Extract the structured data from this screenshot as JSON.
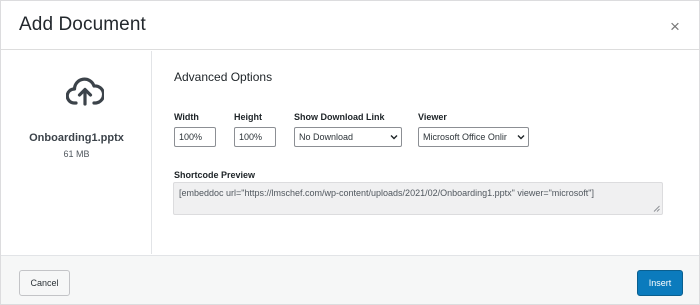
{
  "dialog": {
    "title": "Add Document",
    "close_glyph": "×"
  },
  "file": {
    "icon": "cloud-upload-icon",
    "name": "Onboarding1.pptx",
    "size": "61 MB"
  },
  "options": {
    "section_title": "Advanced Options",
    "width": {
      "label": "Width",
      "value": "100%"
    },
    "height": {
      "label": "Height",
      "value": "100%"
    },
    "download": {
      "label": "Show Download Link",
      "selected": "No Download"
    },
    "viewer": {
      "label": "Viewer",
      "selected": "Microsoft Office Onlir"
    }
  },
  "shortcode": {
    "label": "Shortcode Preview",
    "value": "[embeddoc url=\"https://lmschef.com/wp-content/uploads/2021/02/Onboarding1.pptx\" viewer=\"microsoft\"]"
  },
  "footer": {
    "cancel_label": "Cancel",
    "insert_label": "Insert"
  },
  "colors": {
    "primary_button": "#0b7bbd",
    "footer_bg": "#f6f7f7"
  }
}
